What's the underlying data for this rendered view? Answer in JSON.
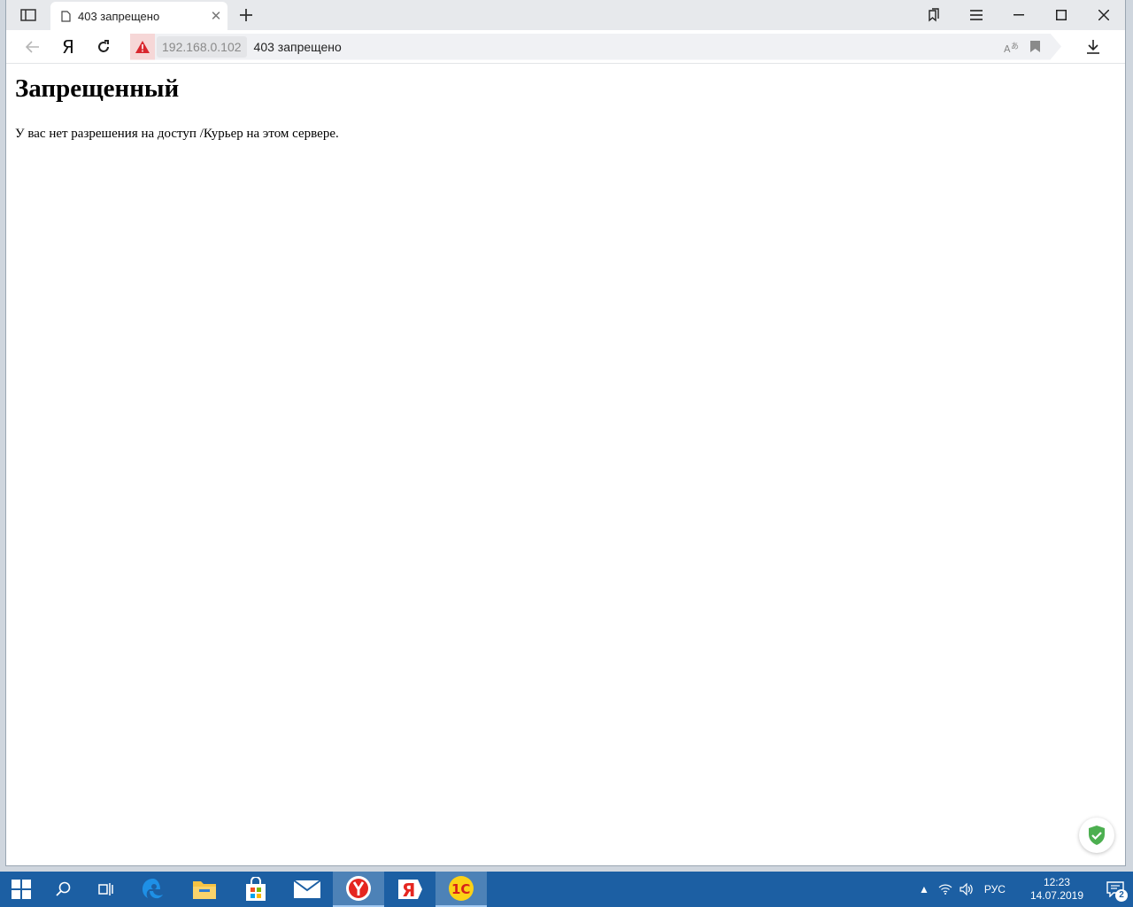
{
  "tab": {
    "title": "403 запрещено"
  },
  "address": {
    "host": "192.168.0.102",
    "title": "403 запрещено"
  },
  "page": {
    "heading": "Запрещенный",
    "message": "У вас нет разрешения на доступ /Курьер на этом сервере."
  },
  "taskbar": {
    "language": "РУС",
    "time": "12:23",
    "date": "14.07.2019",
    "notification_count": "2"
  },
  "colors": {
    "taskbar": "#1c5fa3",
    "warning": "#d9272e",
    "protect": "#4caf50"
  }
}
